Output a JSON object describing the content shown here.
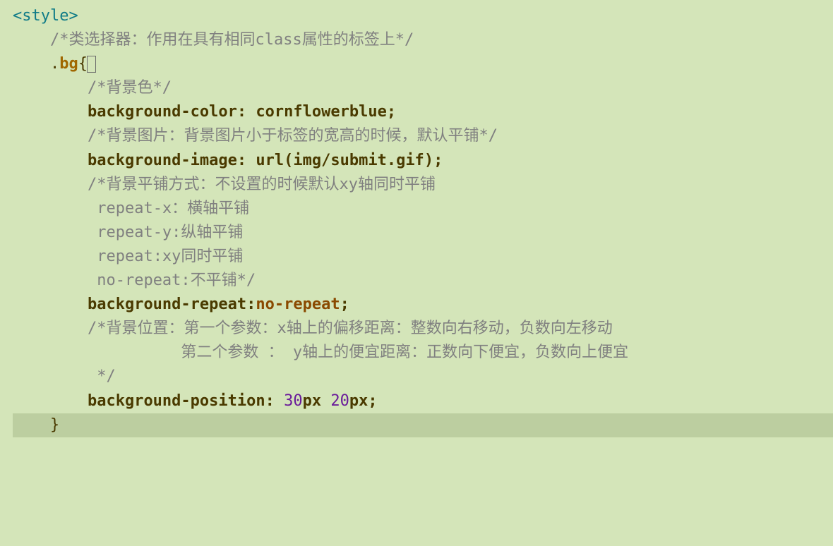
{
  "code": {
    "line1": {
      "openAngle": "<",
      "tagName": "style",
      "closeAngle": ">"
    },
    "line2": {
      "indent": "    ",
      "comment": "/*类选择器：作用在具有相同class属性的标签上*/"
    },
    "line3": {
      "indent": "    ",
      "dot": ".",
      "className": "bg",
      "brace": "{"
    },
    "line4": {
      "indent": "        ",
      "comment": "/*背景色*/"
    },
    "line5": {
      "indent": "        ",
      "prop": "background-color",
      "colon": ": ",
      "value": "cornflowerblue",
      "semi": ";"
    },
    "line6": {
      "indent": "        ",
      "comment": "/*背景图片：背景图片小于标签的宽高的时候，默认平铺*/"
    },
    "line7": {
      "indent": "        ",
      "prop": "background-image",
      "colon": ": ",
      "urlFunc": "url(",
      "urlArg": "img/submit.gif",
      "urlClose": ")",
      "semi": ";"
    },
    "line8": {
      "indent": "        ",
      "comment": "/*背景平铺方式：不设置的时候默认xy轴同时平铺"
    },
    "line9": {
      "indent": "         ",
      "comment": "repeat-x：横轴平铺"
    },
    "line10": {
      "indent": "         ",
      "comment": "repeat-y:纵轴平铺"
    },
    "line11": {
      "indent": "         ",
      "comment": "repeat:xy同时平铺"
    },
    "line12": {
      "indent": "         ",
      "comment": "no-repeat:不平铺*/"
    },
    "line13": {
      "indent": "        ",
      "prop": "background-repeat",
      "colon": ":",
      "value": "no-repeat",
      "semi": ";"
    },
    "line14": {
      "indent": "        ",
      "comment": "/*背景位置：第一个参数：x轴上的偏移距离：整数向右移动，负数向左移动"
    },
    "line15": {
      "indent": "                  ",
      "comment": "第二个参数 ： y轴上的便宜距离：正数向下便宜，负数向上便宜"
    },
    "line16": {
      "indent": "         ",
      "comment": "*/"
    },
    "line17": {
      "indent": "        ",
      "prop": "background-position",
      "colon": ": ",
      "num1": "30",
      "unit1": "px ",
      "num2": "20",
      "unit2": "px",
      "semi": ";"
    },
    "line18": {
      "indent": "    ",
      "brace": "}"
    }
  }
}
